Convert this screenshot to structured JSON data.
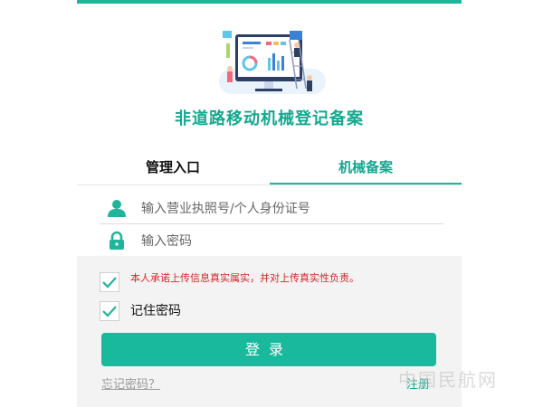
{
  "app": {
    "title": "非道路移动机械登记备案"
  },
  "tabs": [
    {
      "label": "管理入口",
      "active": false
    },
    {
      "label": "机械备案",
      "active": true
    }
  ],
  "form": {
    "license_placeholder": "输入营业执照号/个人身份证号",
    "password_placeholder": "输入密码",
    "agree_text": "本人承诺上传信息真实属实，并对上传真实性负责。",
    "agree_checked": true,
    "remember_text": "记住密码",
    "remember_checked": true,
    "login_label": "登录",
    "forgot_label": "忘记密码？",
    "register_label": "注册"
  },
  "watermark": "中国民航网",
  "colors": {
    "accent": "#1fb59b",
    "button": "#19b99e",
    "warning": "#d6262b"
  },
  "icons": {
    "hero": "dashboard-illustration",
    "user": "user-icon",
    "lock": "lock-icon",
    "check": "check-icon"
  }
}
